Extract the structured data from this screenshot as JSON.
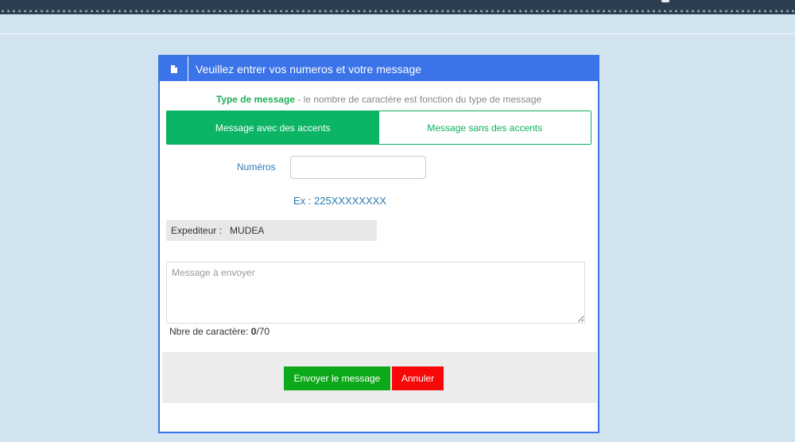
{
  "header": {
    "title": "Veuillez entrer vos numeros et votre message",
    "icon": "file-icon"
  },
  "type_line": {
    "label": "Type de message",
    "description": " - le nombre de caractère est fonction du type de message"
  },
  "toggle": {
    "with_accents": "Message avec des accents",
    "without_accents": "Message sans des accents",
    "selected": "with_accents"
  },
  "numeros": {
    "label": "Numéros",
    "value": "",
    "example": "Ex : 225XXXXXXXX"
  },
  "expediteur": {
    "label": "Expediteur :",
    "value": "MUDEA"
  },
  "message": {
    "placeholder": "Message à envoyer",
    "value": ""
  },
  "counter": {
    "label": "Nbre de caractère: ",
    "current": "0",
    "max": "/70"
  },
  "buttons": {
    "send": "Envoyer le message",
    "cancel": "Annuler"
  },
  "colors": {
    "header_blue": "#3b73e8",
    "toggle_green": "#0bb565",
    "send_green": "#0caa1a",
    "cancel_red": "#f70808"
  }
}
